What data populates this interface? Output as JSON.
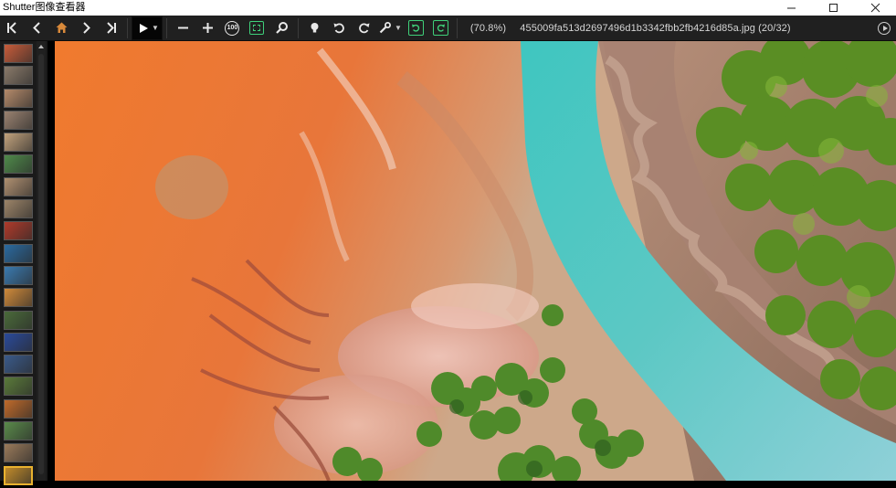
{
  "window": {
    "title": "Shutter图像查看器",
    "minimize": "minimize",
    "maximize": "maximize",
    "close": "close"
  },
  "toolbar": {
    "first_icon": "first-image-icon",
    "prev_icon": "previous-image-icon",
    "home_icon": "home-icon",
    "next_icon": "next-image-icon",
    "last_icon": "last-image-icon",
    "play_icon": "slideshow-play-icon",
    "zoom_out_icon": "zoom-out-icon",
    "zoom_in_icon": "zoom-in-icon",
    "actual_size_label": "100",
    "fit_icon": "fit-to-window-icon",
    "search_icon": "magnifier-icon",
    "light_icon": "lightbulb-icon",
    "rotate_left_icon": "rotate-left-icon",
    "rotate_right_icon": "rotate-right-icon",
    "tools_icon": "wrench-icon",
    "rotate_left_green_icon": "rotate-left-save-icon",
    "rotate_right_green_icon": "rotate-right-save-icon",
    "zoom_text": "(70.8%)",
    "file_text": "455009fa513d2697496d1b3342fbb2fb4216d85a.jpg (20/32)",
    "menu_icon": "menu-circle-icon"
  },
  "thumbnails": {
    "count_visible": 20,
    "active_index": 19,
    "colors": [
      "#c85c3a",
      "#8a7a6a",
      "#b48a6a",
      "#9a8270",
      "#c2a27c",
      "#4f8a4a",
      "#b09070",
      "#9c8468",
      "#b03a2a",
      "#2a6aa0",
      "#3a7ab0",
      "#d08a3a",
      "#4a6a3a",
      "#2a4a9a",
      "#3a5a8a",
      "#5a7a3a",
      "#c06a2a",
      "#5a8a4a",
      "#9a7a5a",
      "#c08a2a"
    ]
  },
  "colors": {
    "toolbar_bg": "#202020",
    "accent_green": "#3fd07a",
    "active_thumb_border": "#e9b22f"
  }
}
